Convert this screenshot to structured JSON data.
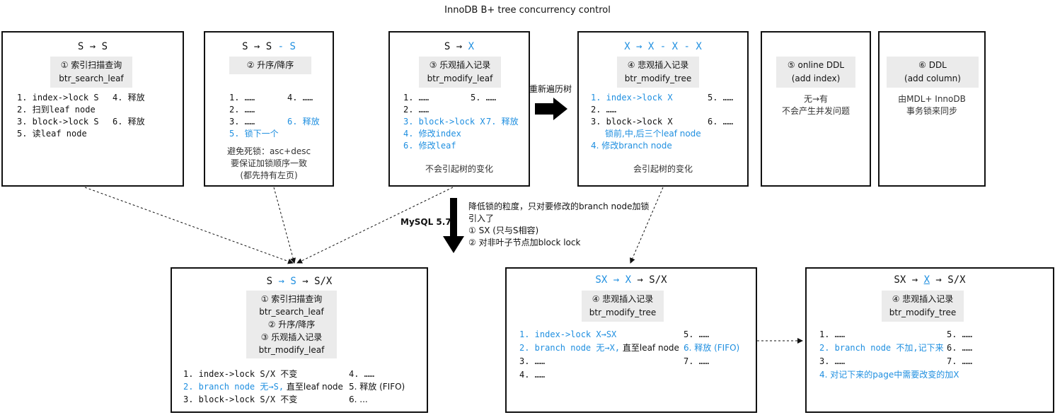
{
  "title": "InnoDB B+ tree concurrency control",
  "boxes": {
    "b1": {
      "header": "S → S",
      "gray": [
        "① 索引扫描查询",
        "btr_search_leaf"
      ],
      "left": [
        "1. index->lock S",
        "2. 扫到leaf node",
        "3. block->lock S",
        "5. 读leaf node"
      ],
      "right": [
        "4. 释放",
        "6. 释放"
      ]
    },
    "b2": {
      "header_a": "S → S",
      "header_b": " - S",
      "gray": [
        "② 升序/降序"
      ],
      "left": [
        "1. ……",
        "2. ……",
        "3. ……"
      ],
      "left_blue": "5. 锁下一个",
      "right": "4. ……",
      "right_blue": "6. 释放",
      "note": [
        "避免死锁：asc+desc",
        "要保证加锁顺序一致",
        "(都先持有左页)"
      ]
    },
    "b3": {
      "header_a": "S → ",
      "header_b": "X",
      "gray": [
        "③ 乐观插入记录",
        "btr_modify_leaf"
      ],
      "left": [
        "1. ……",
        "2. ……"
      ],
      "left_blue": [
        "3. block->lock X",
        "4. 修改index",
        "6. 修改leaf"
      ],
      "right": "5. ……",
      "right_blue": "7. 释放",
      "note": "不会引起树的变化"
    },
    "b4": {
      "header": "X → X - X - X",
      "gray": [
        "④ 悲观插入记录",
        "btr_modify_tree"
      ],
      "l1": "1. index->lock X",
      "l2": "2. ……",
      "l3": "3. block->lock X",
      "l3b": "锁前,中,后三个leaf node",
      "l4": "4. 修改branch node",
      "r1": "5. ……",
      "r2": "6. ……",
      "note": "会引起树的变化"
    },
    "b5": {
      "gray": [
        "⑤ online DDL",
        "(add index)"
      ],
      "note": [
        "无→有",
        "不会产生并发问题"
      ]
    },
    "b6": {
      "gray": [
        "⑥ DDL",
        "(add column)"
      ],
      "note": [
        "由MDL+ InnoDB",
        "事务锁来同步"
      ]
    },
    "b7": {
      "h1": "S",
      "h2": " → S",
      "h3": " → S/X",
      "gray": [
        "① 索引扫描查询",
        "btr_search_leaf",
        "② 升序/降序",
        "③ 乐观插入记录",
        "btr_modify_leaf"
      ],
      "l1": "1. index->lock S/X 不变",
      "l2a": "2. branch node 无→S,",
      "l2b": " 直至leaf node",
      "l3": "3. block->lock S/X 不变",
      "r1": "4. ……",
      "r2": "5. 释放 (FIFO)",
      "r3": "6. ..."
    },
    "b8": {
      "h1": "SX → X",
      "h2": " → S/X",
      "gray": [
        "④ 悲观插入记录",
        "btr_modify_tree"
      ],
      "l1": "1. index->lock X→SX",
      "l2a": "2. branch node 无→X,",
      "l2b": " 直至leaf node",
      "l3": "3. ……",
      "l4": "4. ……",
      "r1": "5. ……",
      "r2": "6. 释放 (FIFO)",
      "r3": "7. ……"
    },
    "b9": {
      "h1": "SX → ",
      "h2": "X",
      "h3": " → S/X",
      "gray": [
        "④ 悲观插入记录",
        "btr_modify_tree"
      ],
      "l1": "1. ……",
      "l2": "2. branch node 不加,记下来",
      "l3": "3. ……",
      "l4": "4. 对记下来的page中需要改变的加X",
      "r1": "5. ……",
      "r2": "6. ……",
      "r3": "7. ……"
    }
  },
  "labels": {
    "traverse": "重新遍历树",
    "mysql": "MySQL 5.7",
    "desc": [
      "降低锁的粒度，只对要修改的branch node加锁",
      "引入了",
      "① SX (只与S相容)",
      "② 对非叶子节点加block lock"
    ]
  },
  "colors": {
    "accent": "#1f8fe0",
    "gray_fill": "#ebebeb"
  }
}
